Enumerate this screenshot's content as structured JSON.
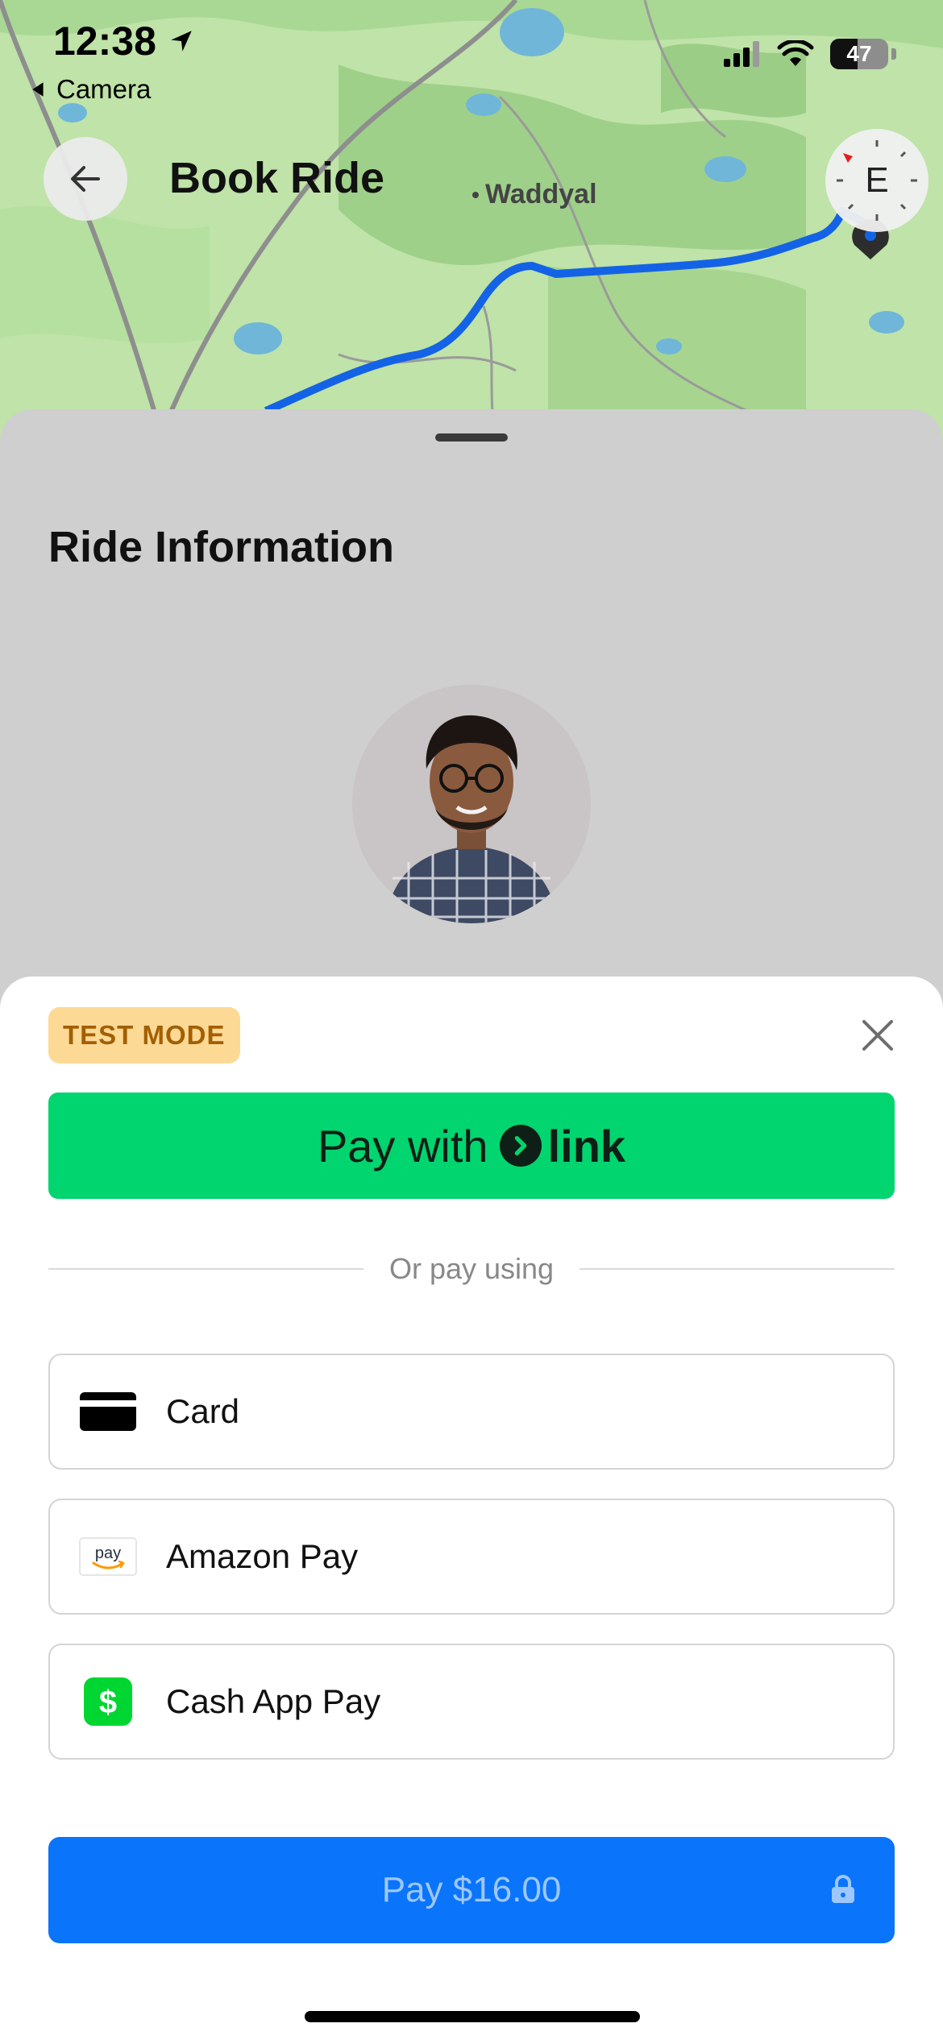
{
  "status_bar": {
    "time": "12:38",
    "back_app": "Camera",
    "battery": "47"
  },
  "header": {
    "title": "Book Ride",
    "compass_label": "E"
  },
  "map": {
    "place_label": "Waddyal"
  },
  "ride_sheet": {
    "title": "Ride Information"
  },
  "payment": {
    "test_mode": "TEST MODE",
    "link_button_prefix": "Pay with",
    "link_brand": "link",
    "divider_text": "Or pay using",
    "methods": [
      {
        "label": "Card",
        "icon": "card-icon"
      },
      {
        "label": "Amazon Pay",
        "icon": "amazon-pay-icon",
        "icon_text": "pay"
      },
      {
        "label": "Cash App Pay",
        "icon": "cash-app-icon",
        "icon_text": "$"
      }
    ],
    "pay_button": "Pay $16.00"
  },
  "colors": {
    "link_green": "#00d56f",
    "pay_blue": "#0a74fb",
    "test_badge_bg": "#fdd996",
    "test_badge_text": "#a35f00",
    "route_blue": "#1463e6"
  }
}
